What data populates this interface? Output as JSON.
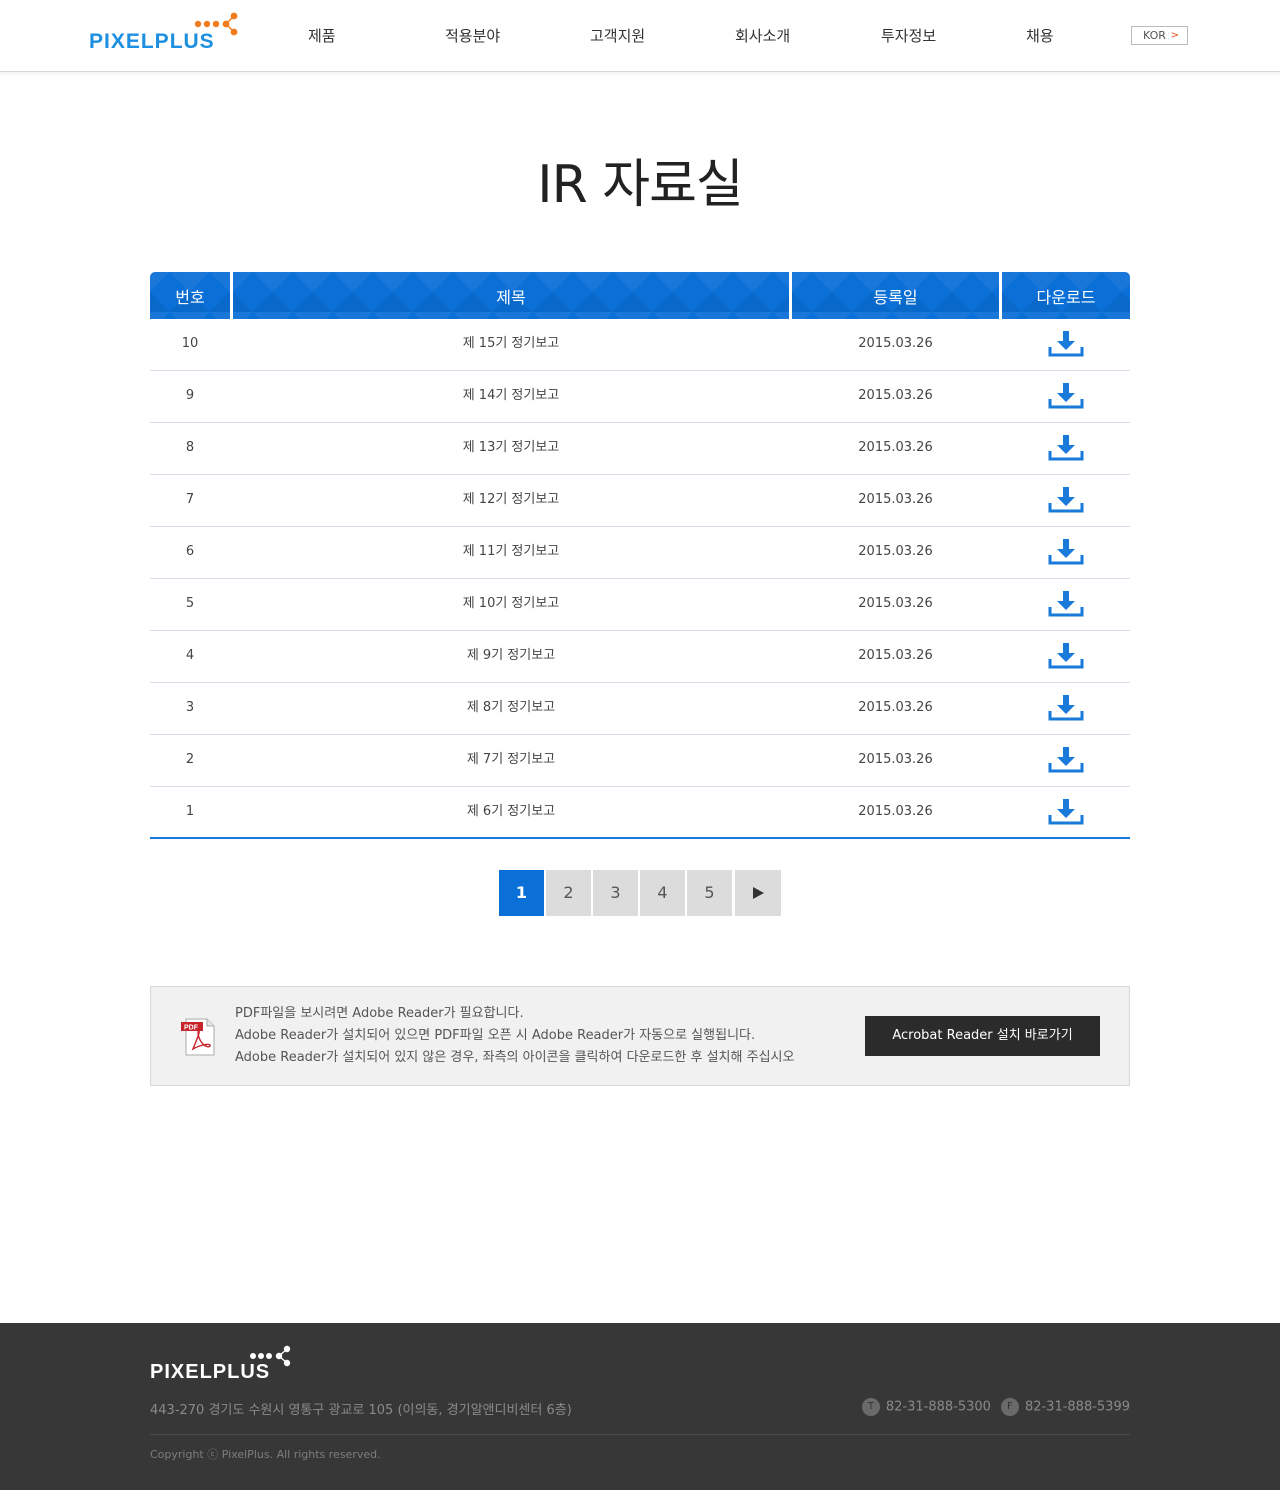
{
  "header": {
    "logo_text": "PIXELPLUS",
    "nav": [
      "제품",
      "적용분야",
      "고객지원",
      "회사소개",
      "투자정보",
      "채용"
    ],
    "lang": "KOR"
  },
  "page_title": "IR 자료실",
  "table": {
    "headers": [
      "번호",
      "제목",
      "등록일",
      "다운로드"
    ],
    "rows": [
      {
        "no": "10",
        "title": "제 15기 정기보고",
        "date": "2015.03.26"
      },
      {
        "no": "9",
        "title": "제 14기 정기보고",
        "date": "2015.03.26"
      },
      {
        "no": "8",
        "title": "제 13기 정기보고",
        "date": "2015.03.26"
      },
      {
        "no": "7",
        "title": "제 12기 정기보고",
        "date": "2015.03.26"
      },
      {
        "no": "6",
        "title": "제 11기 정기보고",
        "date": "2015.03.26"
      },
      {
        "no": "5",
        "title": "제 10기 정기보고",
        "date": "2015.03.26"
      },
      {
        "no": "4",
        "title": "제 9기 정기보고",
        "date": "2015.03.26"
      },
      {
        "no": "3",
        "title": "제 8기 정기보고",
        "date": "2015.03.26"
      },
      {
        "no": "2",
        "title": "제 7기 정기보고",
        "date": "2015.03.26"
      },
      {
        "no": "1",
        "title": "제 6기 정기보고",
        "date": "2015.03.26"
      }
    ],
    "download_icon": "download-icon"
  },
  "pagination": {
    "pages": [
      "1",
      "2",
      "3",
      "4",
      "5"
    ],
    "current": "1",
    "next_icon": "play-next-icon"
  },
  "info": {
    "lines": [
      "PDF파일을 보시려면 Adobe Reader가 필요합니다.",
      "Adobe Reader가 설치되어 있으면 PDF파일 오픈 시 Adobe Reader가 자동으로 실행됩니다.",
      "Adobe Reader가 설치되어 있지 않은 경우, 좌측의 아이콘을 클릭하여 다운로드한 후 설치해 주십시오"
    ],
    "button": "Acrobat Reader 설치 바로가기",
    "pdf_icon_label": "PDF"
  },
  "footer": {
    "logo_text": "PIXELPLUS",
    "address": "443-270 경기도 수원시 영통구 광교로 105 (이의동, 경기알앤디비센터 6층)",
    "tel_badge": "T",
    "tel": "82-31-888-5300",
    "fax_badge": "F",
    "fax": "82-31-888-5399",
    "copyright": "Copyright ⓒ PixelPlus. All rights reserved."
  },
  "colors": {
    "accent": "#0a6fd6",
    "logo_orange": "#f07c1f",
    "footer_bg": "#373737"
  }
}
